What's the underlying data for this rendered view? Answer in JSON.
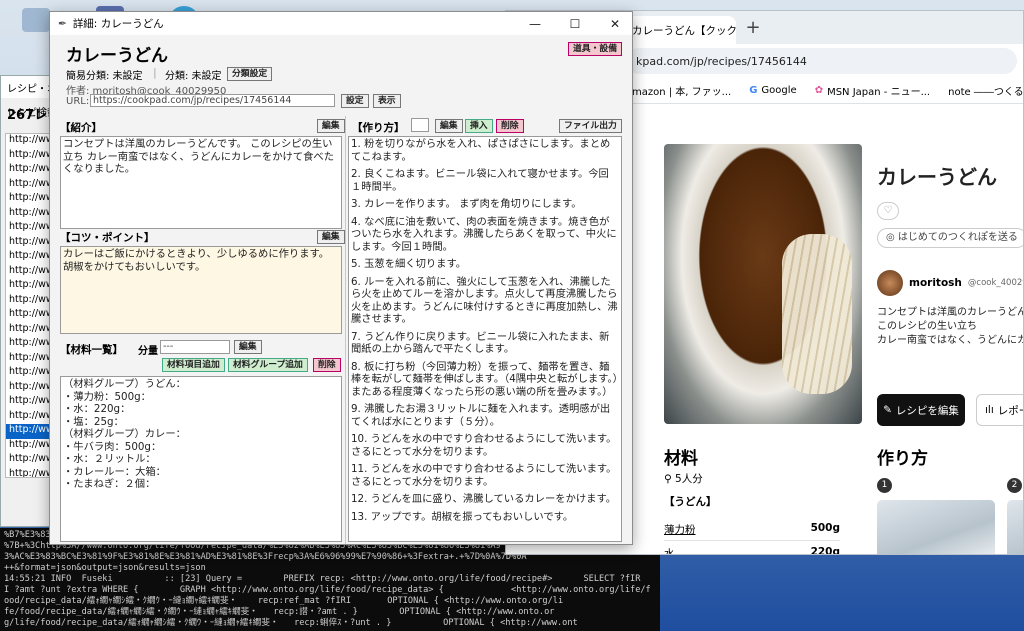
{
  "terminal": {
    "lines": [
      "%B7%E3%83%B3%E3%83%97%E3%83%AA%E3%83%B3%E3%81%AE%E3%83%87%E3%83%BC%E3%82%BF",
      "%7B+%3Chttp%3A//www.onto.org/life/food/recipe_data/%E3%82%AB%E3%83%AC%E3%83%BC%E3%81%86%E3%81%A9",
      "3%AC%E3%83%BC%E3%81%9F%E3%81%8E%E3%81%AD%E3%81%8E%3Frecp%3A%E6%96%99%E7%90%86+%3Fextra+.+%7D%0A%7D%0A",
      "++&format=json&output=json&results=json",
      "14:55:21 INFO  Fuseki          :: [23] Query =        PREFIX recp: <http://www.onto.org/life/food/recipe#>      SELECT ?fIR",
      "I ?amt ?unt ?extra WHERE {        GRAPH <http://www.onto.org/life/food/recipe_data> {             <http://www.onto.org/life/f",
      "ood/recipe_data/繧ｫ繝ｬ繝ｼ繧・ｸ繝ｳ・ｰ縺ｮ繝ｬ繧ｷ繝斐・    recp:ref_mat ?fIRI       OPTIONAL { <http://www.onto.org/li",
      "fe/food/recipe_data/繧ｫ繝ｬ繝ｼ繧・ｸ繝ｳ・ｰ縺ｮ繝ｬ繧ｷ繝斐・   recp:譛・?amt . }        OPTIONAL { <http://www.onto.or",
      "g/life/food/recipe_data/繧ｫ繝ｬ繝ｼ繧・ｸ繝ｳ・ｰ縺ｮ繝ｬ繧ｷ繝斐・   recp:蜊倅ｽ・?unt . }          OPTIONAL { <http://www.ont"
    ]
  },
  "browser": {
    "tab_title": "カレーうどん【クックパッド】",
    "url": "kpad.com/jp/recipes/17456144",
    "bookmarks": [
      "mazon | 本, ファッ...",
      "Google",
      "MSN Japan - ニュー...",
      "note ――つくる、つ..."
    ],
    "recipe_title": "カレーうどん",
    "first_try_label": "はじめてのつくれぽを送る",
    "author_name": "moritosh",
    "author_id": "@cook_40029950",
    "desc_lines": [
      "コンセプトは洋風のカレーうどんです。",
      "このレシピの生い立ち",
      "カレー南蛮ではなく、うどんにカレーをかけて食"
    ],
    "edit_button": "レシピを編集",
    "report_button": "レポー",
    "materials_heading": "材料",
    "servings": "5人分",
    "group": "【うどん】",
    "ingredients": [
      {
        "name": "薄力粉",
        "amount": "500g"
      },
      {
        "name": "水",
        "amount": "220g"
      }
    ],
    "steps_heading": "作り方",
    "step_numbers": [
      "1",
      "2"
    ]
  },
  "backwin": {
    "title": "レシピ・オ",
    "search_label": "レシピ検索:",
    "count": "267レシ",
    "list": [
      "http://ww",
      "http://ww",
      "http://ww",
      "http://ww",
      "http://ww",
      "http://ww",
      "http://ww",
      "http://ww",
      "http://ww",
      "http://ww",
      "http://ww",
      "http://ww",
      "http://ww",
      "http://ww",
      "http://ww",
      "http://ww",
      "http://ww",
      "http://ww",
      "http://ww",
      "http://ww",
      "http://ww",
      "http://ww",
      "http://ww",
      "http://ww"
    ]
  },
  "app": {
    "window_title": "詳細: カレーうどん",
    "recipe_name": "カレーうどん",
    "tools_button": "道具・設備",
    "simple_class_label": "簡易分類: 未設定",
    "class_label": "分類: 未設定",
    "class_set_button": "分類設定",
    "author_label": "作者: moritosh@cook_40029950",
    "url_label": "URL:",
    "url_value": "https://cookpad.com/jp/recipes/17456144",
    "set_button": "設定",
    "show_button": "表示",
    "intro_heading": "【紹介】",
    "edit_label": "編集",
    "intro_text": "コンセプトは洋風のカレーうどんです。 このレシピの生い立ち カレー南蛮ではなく、うどんにカレーをかけて食べたくなりました。",
    "tips_heading": "【コツ・ポイント】",
    "tips_text": "カレーはご飯にかけるときより、少しゆるめに作ります。胡椒をかけてもおいしいです。",
    "materials_heading": "【材料一覧】",
    "amount_label": "分量",
    "amount_value": "---",
    "add_item_button": "材料項目追加",
    "add_group_button": "材料グループ追加",
    "delete_label": "削除",
    "materials_text": "（材料グループ）うどん：\n・薄力粉：500g：\n・水：220g：\n・塩：25g：\n（材料グループ）カレー：\n・牛バラ肉：500g：\n・水：２リットル：\n・カレールー：大箱：\n・たまねぎ：２個：",
    "steps_heading": "【作り方】",
    "insert_button": "挿入",
    "file_output_button": "ファイル出力",
    "steps": [
      "1. 粉を切りながら水を入れ、ぱさぱさにします。まとめてこねます。",
      "2. 良くこねます。ビニール袋に入れて寝かせます。今回１時間半。",
      "3. カレーを作ります。 まず肉を角切りにします。",
      "4. なべ底に油を敷いて、肉の表面を焼きます。焼き色がついたら水を入れます。沸騰したらあくを取って、中火にします。今回１時間。",
      "5. 玉葱を細く切ります。",
      "6. ルーを入れる前に、強火にして玉葱を入れ、沸騰したら火を止めてルーを溶かします。点火して再度沸騰したら火を止めます。うどんに味付けするときに再度加熱し、沸騰させます。",
      "7. うどん作りに戻ります。ビニール袋に入れたまま、新聞紙の上から踏んで平たくします。",
      "8. 板に打ち粉（今回薄力粉）を振って、麺帯を置き、麺棒を転がして麺帯を伸ばします。（4隅中央と転がします。）またある程度薄くなったら形の悪い端の所を畳みます。）",
      "9. 沸騰したお湯３リットルに麺を入れます。透明感が出てくれば水にとります（５分）。",
      "10. うどんを水の中ですり合わせるようにして洗います。さるにとって水分を切ります。",
      "11. うどんを水の中ですり合わせるようにして洗います。さるにとって水分を切ります。",
      "12. うどんを皿に盛り、沸騰しているカレーをかけます。",
      "13. アップです。胡椒を振ってもおいしいです。"
    ]
  }
}
